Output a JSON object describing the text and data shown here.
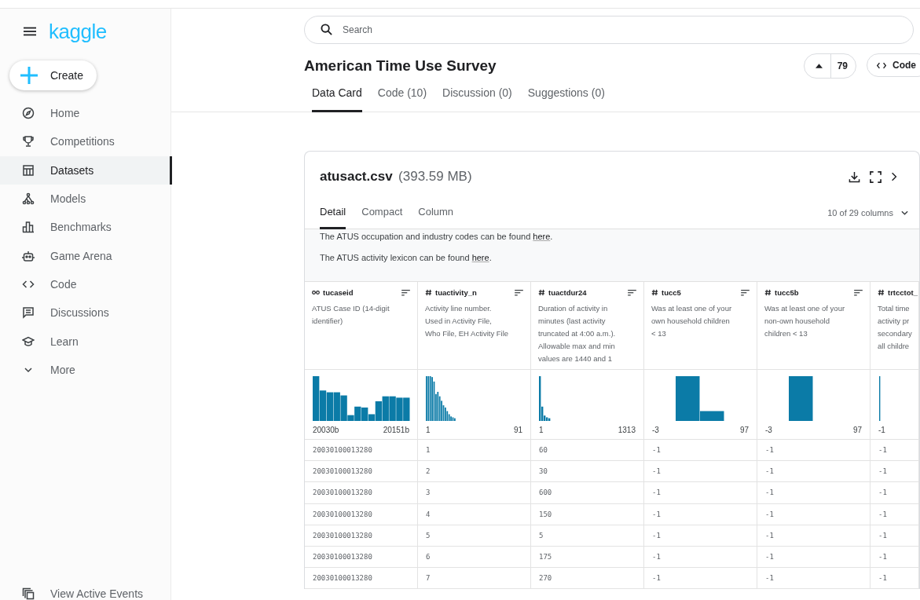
{
  "sidebar": {
    "logo": "kaggle",
    "create_label": "Create",
    "items": [
      {
        "label": "Home",
        "selected": false
      },
      {
        "label": "Competitions",
        "selected": false
      },
      {
        "label": "Datasets",
        "selected": true
      },
      {
        "label": "Models",
        "selected": false
      },
      {
        "label": "Benchmarks",
        "selected": false
      },
      {
        "label": "Game Arena",
        "selected": false
      },
      {
        "label": "Code",
        "selected": false
      },
      {
        "label": "Discussions",
        "selected": false
      },
      {
        "label": "Learn",
        "selected": false
      },
      {
        "label": "More",
        "selected": false
      }
    ],
    "footer_link": "View Active Events"
  },
  "search": {
    "placeholder": "Search"
  },
  "dataset": {
    "title": "American Time Use Survey",
    "votes": "79",
    "code_button": "Code"
  },
  "tabs": [
    {
      "label": "Data Card",
      "selected": true
    },
    {
      "label": "Code (10)",
      "selected": false
    },
    {
      "label": "Discussion (0)",
      "selected": false
    },
    {
      "label": "Suggestions (0)",
      "selected": false
    }
  ],
  "file": {
    "name": "atusact.csv",
    "size": "(393.59 MB)",
    "view_tabs": [
      {
        "label": "Detail",
        "selected": true
      },
      {
        "label": "Compact",
        "selected": false
      },
      {
        "label": "Column",
        "selected": false
      }
    ],
    "columns_picker": "10 of 29 columns",
    "notes": [
      {
        "text": "The ATUS occupation and industry codes can be found ",
        "link": "here",
        "end": "."
      },
      {
        "text": "The ATUS activity lexicon can be found ",
        "link": "here",
        "end": "."
      }
    ]
  },
  "table": {
    "columns": [
      {
        "name": "tucaseid",
        "kind": "id",
        "description": [
          "ATUS Case ID (14-digit",
          "identifier)"
        ],
        "min": "20030b",
        "max": "20151b"
      },
      {
        "name": "tuactivity_n",
        "kind": "numeric",
        "description": [
          "Activity line number.",
          "Used in Activity File,",
          "Who File, EH Activity File"
        ],
        "min": "1",
        "max": "91"
      },
      {
        "name": "tuactdur24",
        "kind": "numeric",
        "description": [
          "Duration of activity in",
          "minutes (last activity",
          "truncated at 4:00 a.m.).",
          "Allowable max and min",
          "values are 1440 and 1"
        ],
        "min": "1",
        "max": "1313"
      },
      {
        "name": "tucc5",
        "kind": "numeric",
        "description": [
          "Was at least one of your",
          "own household children",
          "< 13"
        ],
        "min": "-3",
        "max": "97"
      },
      {
        "name": "tucc5b",
        "kind": "numeric",
        "description": [
          "Was at least one of your",
          "non-own household",
          "children < 13"
        ],
        "min": "-3",
        "max": "97"
      },
      {
        "name": "trtcctot_",
        "kind": "numeric",
        "description": [
          "Total time",
          "activity pr",
          "secondary",
          "all childre"
        ],
        "min": "-1"
      }
    ],
    "rows": [
      [
        "20030100013280",
        "1",
        "60",
        "-1",
        "-1",
        "-1"
      ],
      [
        "20030100013280",
        "2",
        "30",
        "-1",
        "-1",
        "-1"
      ],
      [
        "20030100013280",
        "3",
        "600",
        "-1",
        "-1",
        "-1"
      ],
      [
        "20030100013280",
        "4",
        "150",
        "-1",
        "-1",
        "-1"
      ],
      [
        "20030100013280",
        "5",
        "5",
        "-1",
        "-1",
        "-1"
      ],
      [
        "20030100013280",
        "6",
        "175",
        "-1",
        "-1",
        "-1"
      ],
      [
        "20030100013280",
        "7",
        "270",
        "-1",
        "-1",
        "-1"
      ]
    ]
  }
}
